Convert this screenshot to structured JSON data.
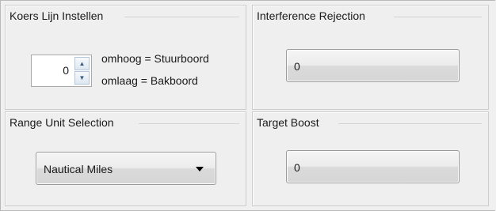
{
  "koers": {
    "title": "Koers Lijn Instellen",
    "value": "0",
    "up_hint": "omhoog = Stuurboord",
    "down_hint": "omlaag = Bakboord"
  },
  "interference": {
    "title": "Interference Rejection",
    "value": "0"
  },
  "range_unit": {
    "title": "Range Unit Selection",
    "selected": "Nautical Miles"
  },
  "target_boost": {
    "title": "Target Boost",
    "value": "0"
  },
  "icons": {
    "spin_up": "up-arrow-icon",
    "spin_down": "down-arrow-icon",
    "dropdown": "chevron-down-icon"
  }
}
